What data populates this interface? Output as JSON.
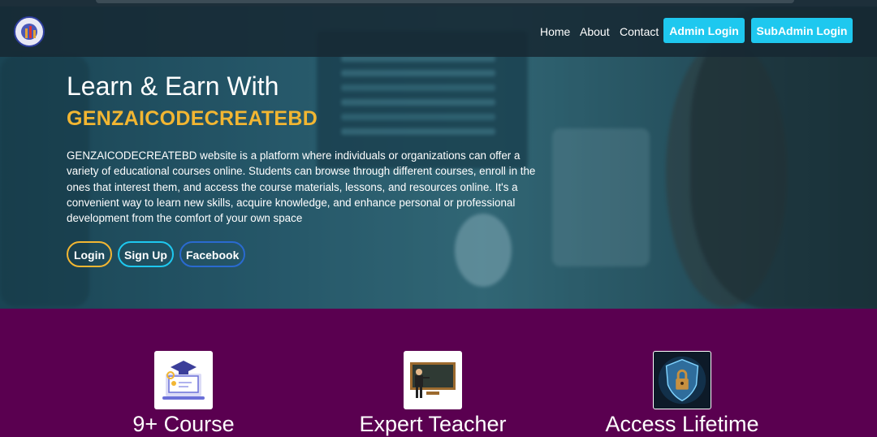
{
  "nav": {
    "links": [
      "Home",
      "About",
      "Contact"
    ],
    "admin_login": "Admin Login",
    "subadmin_login": "SubAdmin Login",
    "accent": "#1ec8ef"
  },
  "hero": {
    "heading": "Learn & Earn With",
    "brand": "GENZAICODECREATEBD",
    "brand_color": "#f2b632",
    "description": "GENZAICODECREATEBD website is a platform where individuals or organizations can offer a variety of educational courses online. Students can browse through different courses, enroll in the ones that interest them, and access the course materials, lessons, and resources online. It's a convenient way to learn new skills, acquire knowledge, and enhance personal or professional development from the comfort of your own space",
    "buttons": [
      "Login",
      "Sign Up",
      "Facebook"
    ]
  },
  "features": {
    "background": "#5a0050",
    "items": [
      {
        "title": "9+ Course",
        "icon": "online-course-icon"
      },
      {
        "title": "Expert Teacher",
        "icon": "teacher-blackboard-icon"
      },
      {
        "title": "Access Lifetime",
        "icon": "shield-lock-icon"
      }
    ]
  }
}
